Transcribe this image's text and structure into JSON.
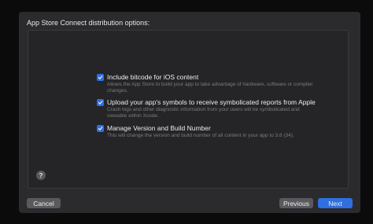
{
  "sheet": {
    "title": "App Store Connect distribution options:"
  },
  "options": [
    {
      "checked": true,
      "label": "Include bitcode for iOS content",
      "description": "Allows the App Store to build your app to take advantage of hardware, software or compiler changes."
    },
    {
      "checked": true,
      "label": "Upload your app's symbols to receive symbolicated reports from Apple",
      "description": "Crash logs and other diagnostic information from your users will be symbolicated and viewable within Xcode."
    },
    {
      "checked": true,
      "label": "Manage Version and Build Number",
      "description": "This will change the version and build number of all content in your app to 3.6 (34)."
    }
  ],
  "help": {
    "label": "?"
  },
  "footer": {
    "cancel_label": "Cancel",
    "previous_label": "Previous",
    "next_label": "Next"
  },
  "colors": {
    "accent": "#2f6fe0",
    "sheet_background": "#2b2a2d",
    "secondary_button": "#5a595d"
  },
  "icons": {
    "checkbox": "checkmark-icon",
    "help": "question-mark-icon"
  }
}
